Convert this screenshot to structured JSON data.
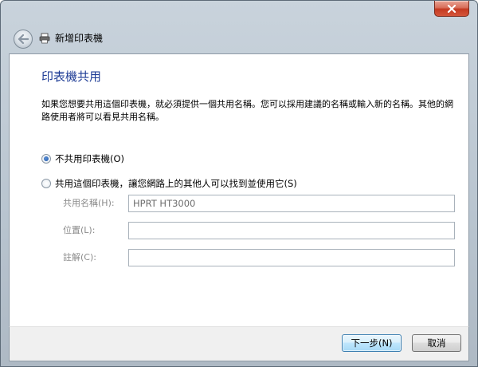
{
  "window": {
    "title": "新增印表機"
  },
  "page": {
    "heading": "印表機共用",
    "description": "如果您想要共用這個印表機，就必須提供一個共用名稱。您可以採用建議的名稱或輸入新的名稱。其他的網路使用者將可以看見共用名稱。"
  },
  "options": {
    "no_share_label": "不共用印表機(O)",
    "share_label": "共用這個印表機，讓您網路上的其他人可以找到並使用它(S)",
    "selected": "no_share"
  },
  "fields": {
    "share_name": {
      "label": "共用名稱(H):",
      "value": "HPRT HT3000"
    },
    "location": {
      "label": "位置(L):",
      "value": ""
    },
    "comment": {
      "label": "註解(C):",
      "value": ""
    }
  },
  "buttons": {
    "next_label": "下一步(N)",
    "cancel_label": "取消"
  },
  "icons": {
    "close": "close-icon",
    "back": "back-arrow-icon",
    "printer": "printer-icon"
  },
  "colors": {
    "heading": "#1e3c96",
    "close_button": "#c43a21",
    "radio_selected": "#1f57a8"
  }
}
